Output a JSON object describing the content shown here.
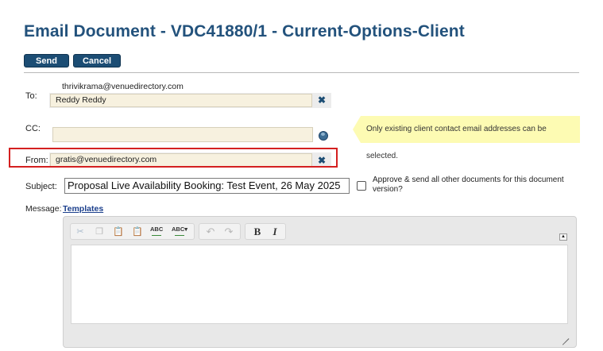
{
  "page": {
    "title": "Email Document - VDC41880/1 - Current-Options-Client"
  },
  "actions": {
    "send_label": "Send",
    "cancel_label": "Cancel"
  },
  "to": {
    "label": "To:",
    "address": "thrivikrama@venuedirectory.com",
    "value": "Reddy Reddy",
    "clear_icon": "close-icon"
  },
  "cc": {
    "label": "CC:",
    "value": "",
    "lookup_icon": "globe-icon"
  },
  "hint": {
    "text": "Only existing client contact email addresses can be selected."
  },
  "from": {
    "label": "From:",
    "value": "gratis@venuedirectory.com",
    "clear_icon": "close-icon",
    "highlight_color": "#d42020"
  },
  "subject": {
    "label": "Subject:",
    "value": "Proposal Live Availability Booking: Test Event, 26 May 2025",
    "approve_text": "Approve & send all other documents for this document version?",
    "approve_checked": false
  },
  "message": {
    "label": "Message:",
    "templates_link": "Templates",
    "toolbar": {
      "spell_label": "ABC",
      "spell_dropdown_label": "ABC",
      "bold_label": "B",
      "italic_label": "I"
    },
    "body": ""
  },
  "colors": {
    "title": "#23527c",
    "button": "#1c4d74",
    "field_bg": "#f7f1df",
    "hint_bg": "#fdfbb3"
  }
}
